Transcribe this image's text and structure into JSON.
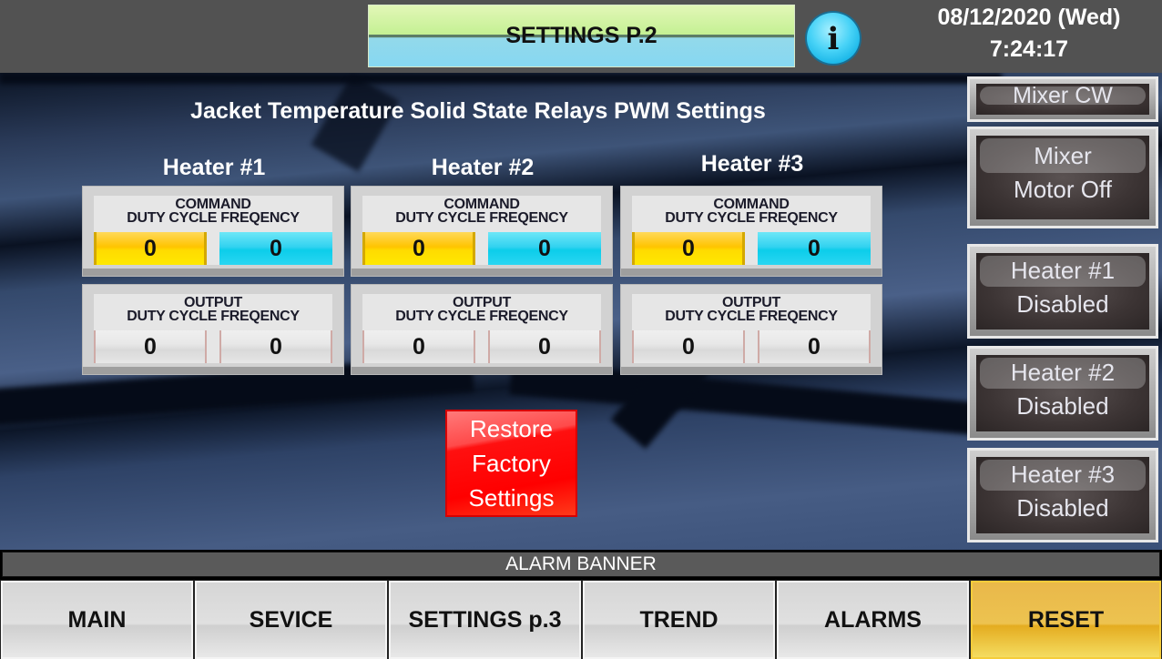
{
  "header": {
    "title": "SETTINGS P.2",
    "info_icon": "info-icon",
    "date": "08/12/2020 (Wed)",
    "time": "7:24:17"
  },
  "main": {
    "heading": "Jacket Temperature Solid State Relays PWM Settings",
    "heaters": [
      {
        "title": "Heater #1",
        "command": {
          "label": "COMMAND",
          "duty_label": "DUTY CYCLE",
          "freq_label": "FREQENCY",
          "duty_value": "0",
          "freq_value": "0"
        },
        "output": {
          "label": "OUTPUT",
          "duty_label": "DUTY CYCLE",
          "freq_label": "FREQENCY",
          "duty_value": "0",
          "freq_value": "0"
        }
      },
      {
        "title": "Heater #2",
        "command": {
          "label": "COMMAND",
          "duty_label": "DUTY CYCLE",
          "freq_label": "FREQENCY",
          "duty_value": "0",
          "freq_value": "0"
        },
        "output": {
          "label": "OUTPUT",
          "duty_label": "DUTY CYCLE",
          "freq_label": "FREQENCY",
          "duty_value": "0",
          "freq_value": "0"
        }
      },
      {
        "title": "Heater #3",
        "command": {
          "label": "COMMAND",
          "duty_label": "DUTY CYCLE",
          "freq_label": "FREQENCY",
          "duty_value": "0",
          "freq_value": "0"
        },
        "output": {
          "label": "OUTPUT",
          "duty_label": "DUTY CYCLE",
          "freq_label": "FREQENCY",
          "duty_value": "0",
          "freq_value": "0"
        }
      }
    ],
    "restore_button": {
      "line1": "Restore",
      "line2": "Factory",
      "line3": "Settings"
    }
  },
  "sidebar": {
    "mixer_direction": "Mixer CW",
    "mixer_motor": {
      "line1": "Mixer",
      "line2": "Motor Off"
    },
    "heater1": {
      "line1": "Heater #1",
      "line2": "Disabled"
    },
    "heater2": {
      "line1": "Heater #2",
      "line2": "Disabled"
    },
    "heater3": {
      "line1": "Heater #3",
      "line2": "Disabled"
    }
  },
  "alarm_banner": "ALARM BANNER",
  "nav": {
    "main": "MAIN",
    "service": "SEVICE",
    "settings3": "SETTINGS p.3",
    "trend": "TREND",
    "alarms": "ALARMS",
    "reset": "RESET"
  },
  "colors": {
    "duty_accent": "#FFC400",
    "freq_accent": "#0CCDEA",
    "restore_red": "#FF0000",
    "reset_gold": "#EDC350"
  }
}
